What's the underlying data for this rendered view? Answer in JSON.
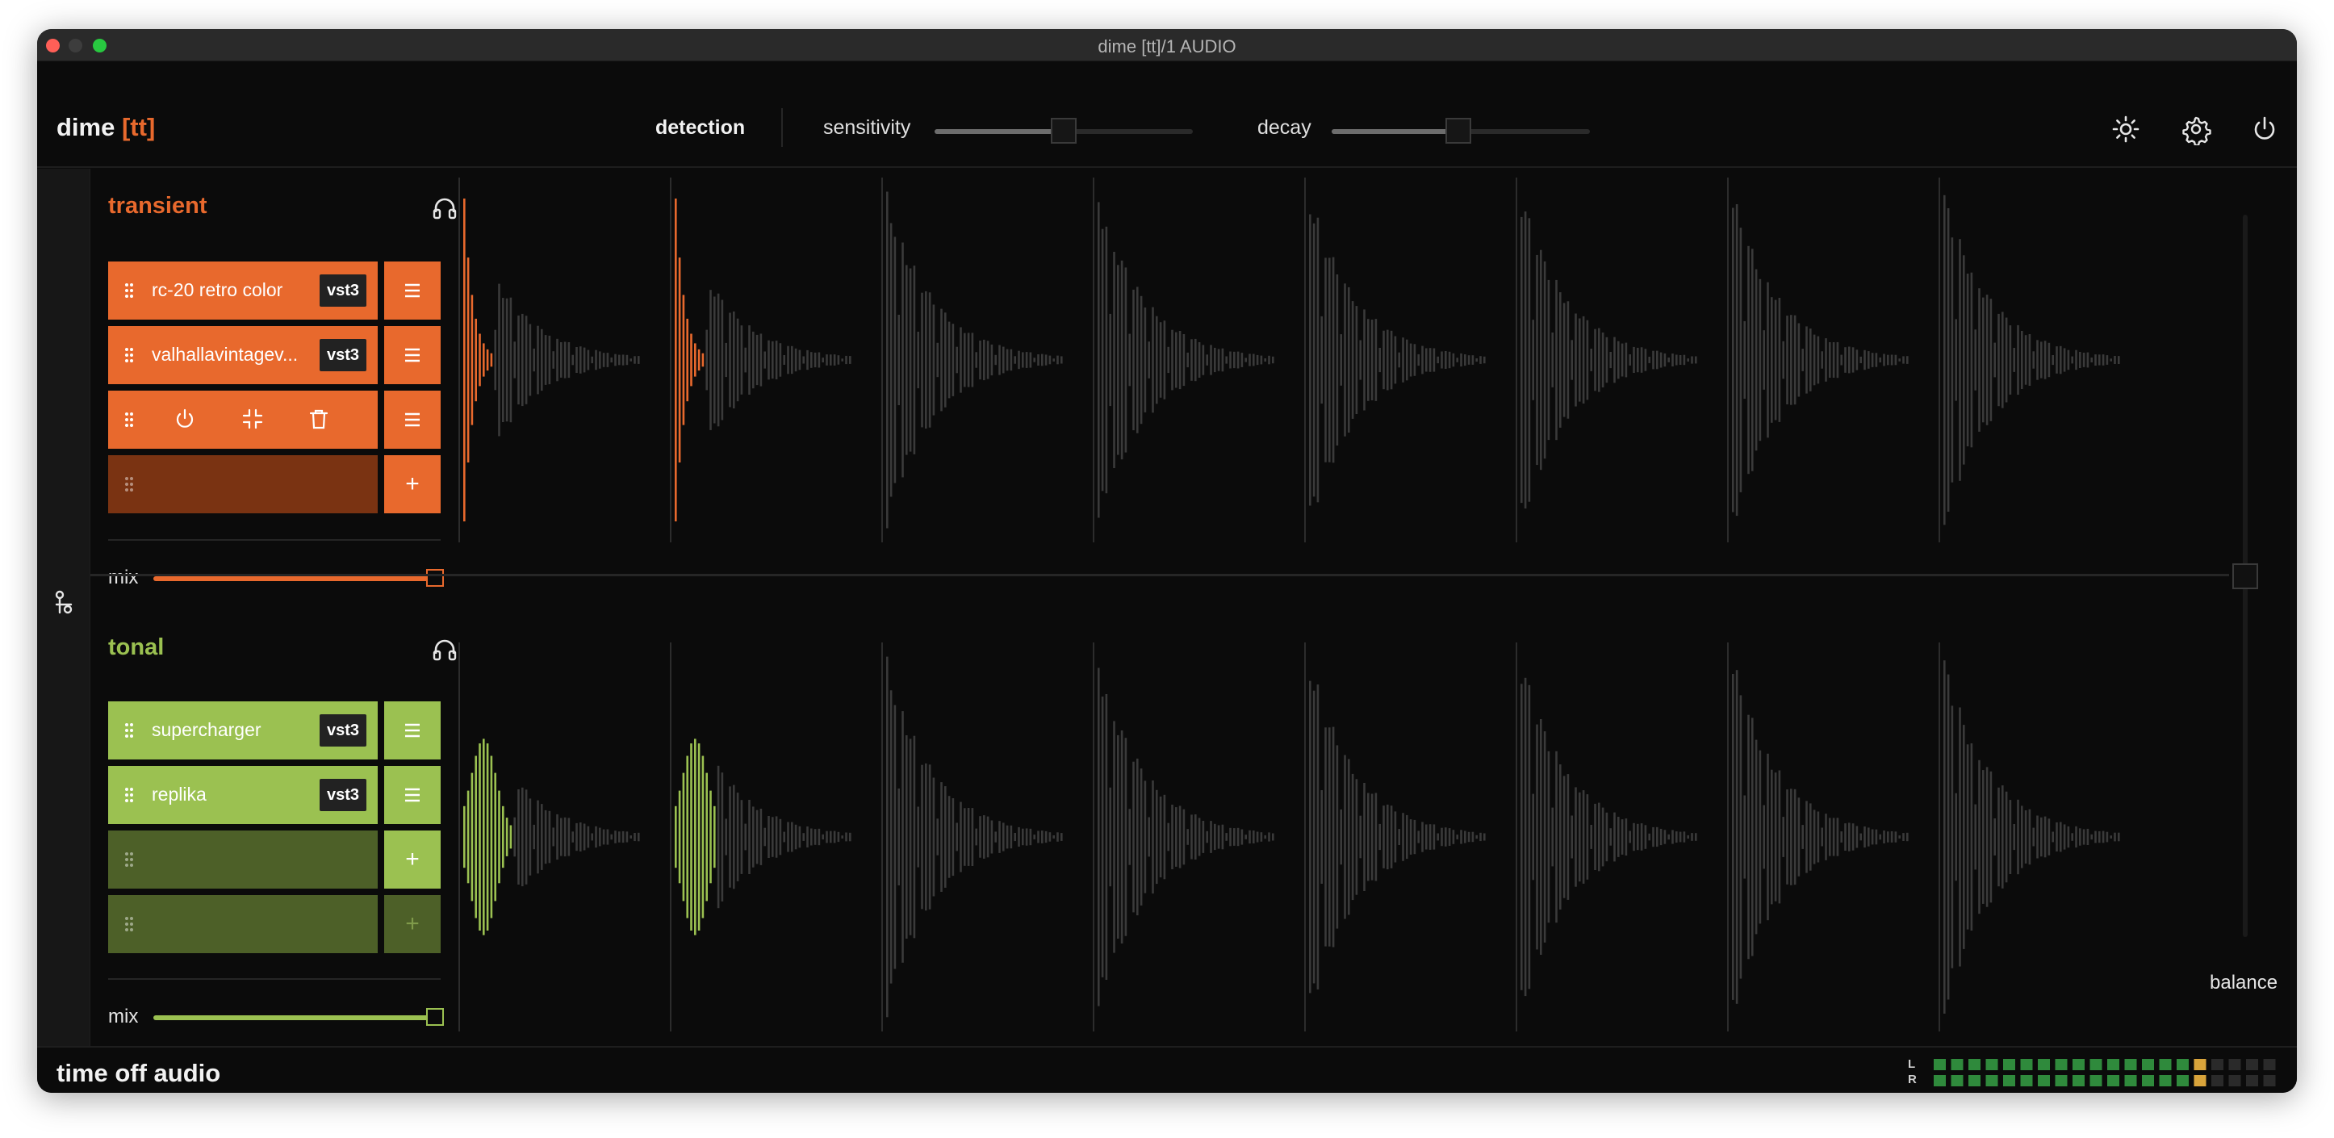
{
  "window": {
    "title": "dime [tt]/1 AUDIO"
  },
  "header": {
    "logo_main": "dime ",
    "logo_bracket": "[tt]",
    "detection_label": "detection",
    "sensitivity_label": "sensitivity",
    "sensitivity_value": 0.5,
    "decay_label": "decay",
    "decay_value": 0.49,
    "icons": [
      "brightness-icon",
      "settings-gear-icon",
      "power-icon"
    ]
  },
  "transient": {
    "title": "transient",
    "color": "#e8692d",
    "slot_colors": {
      "active": "#e8692d",
      "empty": "#7a3312"
    },
    "plugins": [
      {
        "name": "rc-20 retro color",
        "format": "vst3"
      },
      {
        "name": "valhallavintagev...",
        "format": "vst3"
      }
    ],
    "selected_slot_tools": [
      "power-icon",
      "compress-icon",
      "trash-icon"
    ],
    "add_label": "+",
    "mix_label": "mix",
    "mix_value": 1.0
  },
  "tonal": {
    "title": "tonal",
    "color": "#9bc151",
    "slot_colors": {
      "active": "#9bc151",
      "empty": "#4d6028"
    },
    "plugins": [
      {
        "name": "supercharger",
        "format": "vst3"
      },
      {
        "name": "replika",
        "format": "vst3"
      }
    ],
    "add_label": "+",
    "mix_label": "mix",
    "mix_value": 1.0
  },
  "balance": {
    "label": "balance",
    "value": 0.5
  },
  "footer": {
    "brand": "time off audio",
    "meter_left_label": "L",
    "meter_right_label": "R",
    "meter_left_level": 0.79,
    "meter_right_level": 0.79,
    "meter_colors": {
      "low": "#2f8a3c",
      "high": "#d9a43b",
      "off": "#2a2a2a"
    }
  }
}
